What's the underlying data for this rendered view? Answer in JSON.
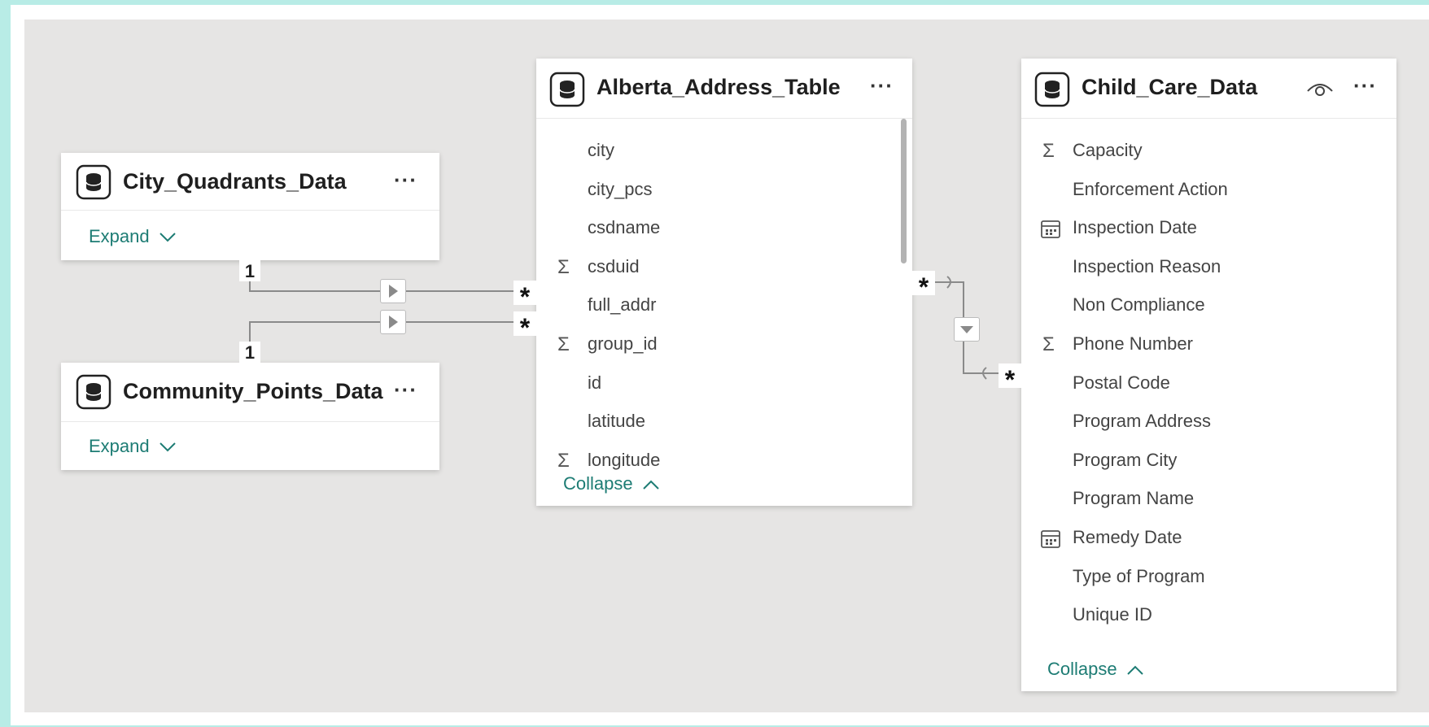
{
  "tables": {
    "city_quadrants": {
      "title": "City_Quadrants_Data",
      "more": "···",
      "expand": "Expand"
    },
    "community_points": {
      "title": "Community_Points_Data",
      "more": "···",
      "expand": "Expand"
    },
    "alberta_address": {
      "title": "Alberta_Address_Table",
      "more": "···",
      "collapse": "Collapse",
      "fields": [
        {
          "name": "city",
          "icon": ""
        },
        {
          "name": "city_pcs",
          "icon": ""
        },
        {
          "name": "csdname",
          "icon": ""
        },
        {
          "name": "csduid",
          "icon": "Σ"
        },
        {
          "name": "full_addr",
          "icon": ""
        },
        {
          "name": "group_id",
          "icon": "Σ"
        },
        {
          "name": "id",
          "icon": ""
        },
        {
          "name": "latitude",
          "icon": ""
        },
        {
          "name": "longitude",
          "icon": "Σ"
        }
      ]
    },
    "child_care": {
      "title": "Child_Care_Data",
      "more": "···",
      "collapse": "Collapse",
      "fields": [
        {
          "name": "Capacity",
          "icon": "Σ"
        },
        {
          "name": "Enforcement Action",
          "icon": ""
        },
        {
          "name": "Inspection Date",
          "icon": "calendar-icon"
        },
        {
          "name": "Inspection Reason",
          "icon": ""
        },
        {
          "name": "Non Compliance",
          "icon": ""
        },
        {
          "name": "Phone Number",
          "icon": "Σ"
        },
        {
          "name": "Postal Code",
          "icon": ""
        },
        {
          "name": "Program Address",
          "icon": ""
        },
        {
          "name": "Program City",
          "icon": ""
        },
        {
          "name": "Program Name",
          "icon": ""
        },
        {
          "name": "Remedy Date",
          "icon": "calendar-icon"
        },
        {
          "name": "Type of Program",
          "icon": ""
        },
        {
          "name": "Unique ID",
          "icon": ""
        }
      ]
    }
  },
  "relationships": {
    "one_label": "1",
    "many_label": "*"
  },
  "colors": {
    "accent": "#1d7c74",
    "canvas": "#e6e5e4",
    "background": "#b8ece6"
  }
}
